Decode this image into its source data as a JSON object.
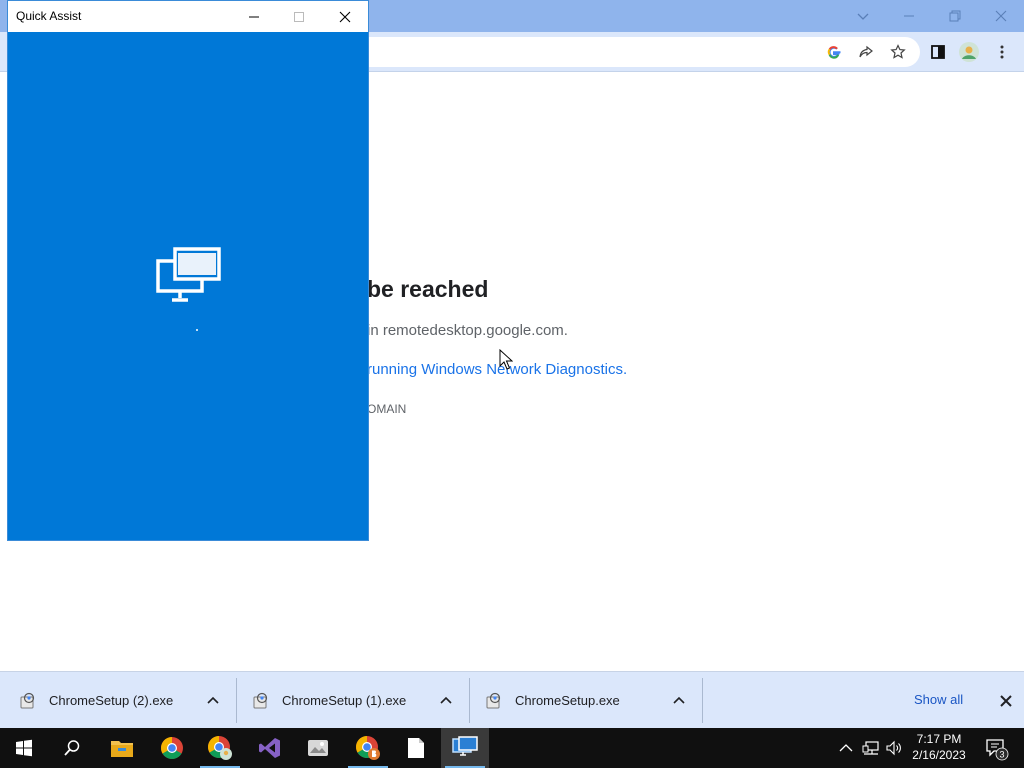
{
  "browser": {
    "toolbar_icons": [
      "google-icon",
      "share-icon",
      "bookmark-star-icon",
      "side-panel-icon",
      "profile-avatar-icon",
      "more-menu-icon"
    ],
    "error": {
      "title": "be reached",
      "host_line": "in remotedesktop.google.com.",
      "diagnostics_link": "running Windows Network Diagnostics.",
      "error_code": "OMAIN"
    }
  },
  "quick_assist": {
    "title": "Quick Assist",
    "bg_color": "#0078d7"
  },
  "downloads": {
    "items": [
      {
        "filename": "ChromeSetup (2).exe"
      },
      {
        "filename": "ChromeSetup (1).exe"
      },
      {
        "filename": "ChromeSetup.exe"
      }
    ],
    "show_all": "Show all"
  },
  "taskbar": {
    "apps": [
      "start-icon",
      "search-icon",
      "file-explorer-icon",
      "chrome-icon",
      "chrome-user-icon",
      "visual-studio-icon",
      "image-app-icon",
      "chrome-profile-b-icon",
      "document-icon",
      "quick-assist-icon"
    ],
    "clock": {
      "time": "7:17 PM",
      "date": "2/16/2023"
    },
    "notification_count": "3"
  }
}
